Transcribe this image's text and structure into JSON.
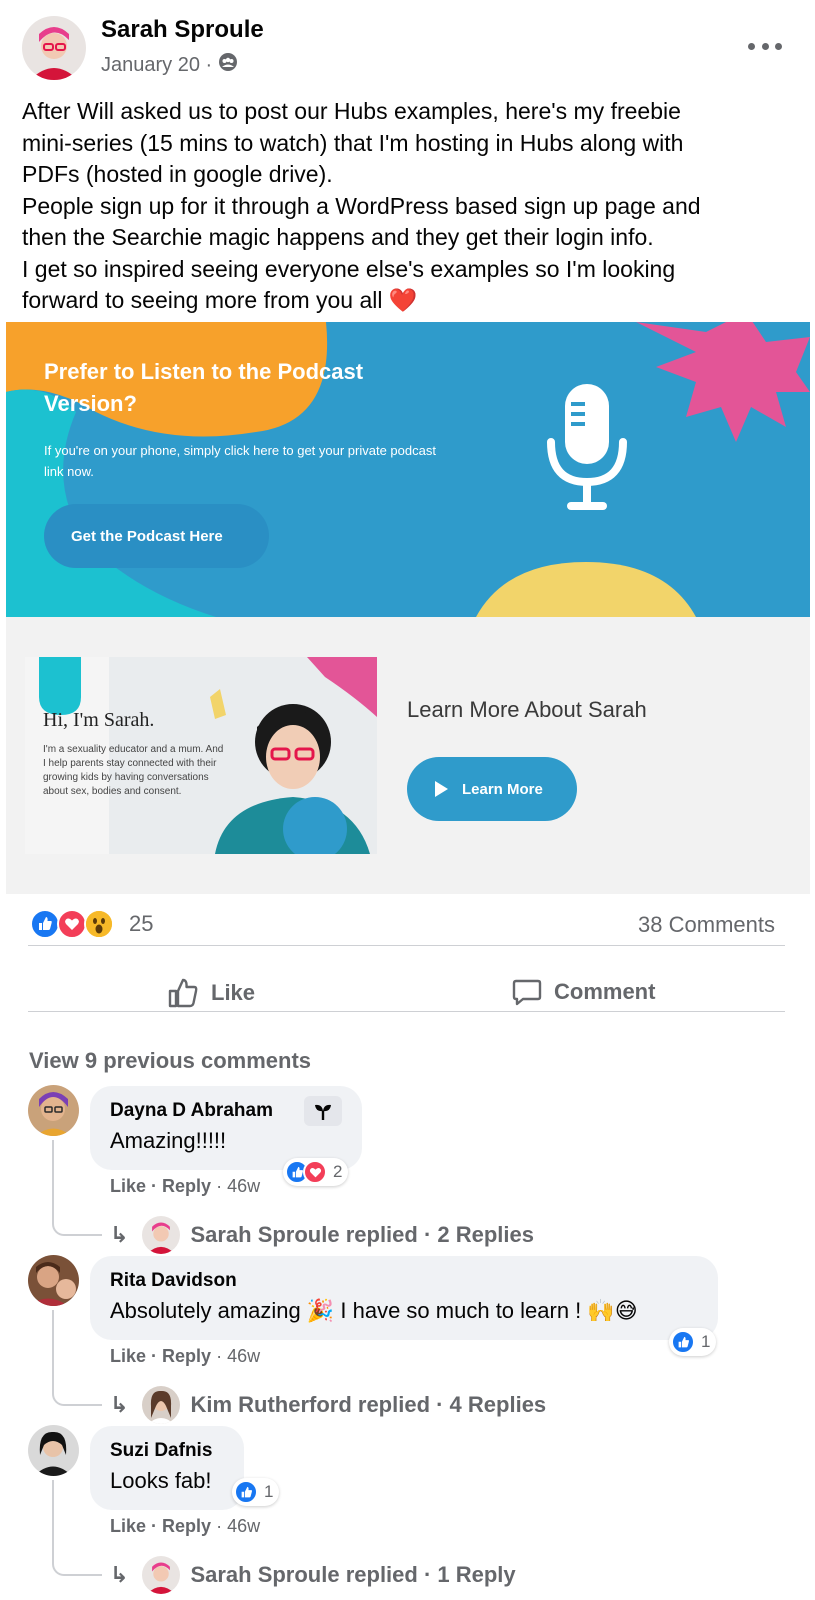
{
  "post": {
    "author": "Sarah Sproule",
    "date": "January 20 ·",
    "privacy_icon": "group-audience-icon",
    "more_icon": "more-options-icon",
    "text_lines": [
      "After Will asked us to post our Hubs examples, here's my freebie",
      "mini-series (15 mins to watch) that I'm hosting in Hubs along with",
      "PDFs (hosted in google drive).",
      "People sign up for it through a WordPress based sign up page and",
      "then the Searchie magic happens and they get their login info.",
      "I get so inspired seeing everyone else's examples so I'm looking",
      "forward to seeing more from you all ❤️"
    ]
  },
  "banner": {
    "title": "Prefer to Listen to the Podcast Version?",
    "subtitle": "If you're on your phone, simply click here to get your private podcast link now.",
    "button_label": "Get the Podcast Here",
    "icon": "microphone-icon",
    "colors": {
      "background": "#2f9bcb",
      "orange": "#f7a12b",
      "teal": "#1cc1d0",
      "pink": "#e35597",
      "yellow": "#f2d46a"
    }
  },
  "about": {
    "card_greeting": "Hi, I'm Sarah.",
    "card_bio": "I'm a sexuality educator and a mum. And I help parents stay connected with their growing kids by having conversations about sex, bodies and consent.",
    "heading": "Learn More About Sarah",
    "button_label": "Learn More"
  },
  "engagement": {
    "reaction_count": "25",
    "comments_label": "38 Comments",
    "reaction_icons": [
      "like-reaction-icon",
      "love-reaction-icon",
      "wow-reaction-icon"
    ],
    "like_label": "Like",
    "comment_label": "Comment"
  },
  "comments": {
    "view_previous": "View 9 previous comments",
    "items": [
      {
        "name": "Dayna D Abraham",
        "text": "Amazing!!!!!",
        "like": "Like",
        "reply": "Reply",
        "age": "· 46w",
        "reaction_count": "2",
        "replied_by": "Sarah Sproule replied · 2 Replies"
      },
      {
        "name": "Rita Davidson",
        "text": "Absolutely amazing 🎉 I have so much to learn ! 🙌😅",
        "like": "Like",
        "reply": "Reply",
        "age": "· 46w",
        "reaction_count": "1",
        "replied_by": "Kim Rutherford replied · 4 Replies"
      },
      {
        "name": "Suzi Dafnis",
        "text": "Looks fab!",
        "like": "Like",
        "reply": "Reply",
        "age": "· 46w",
        "reaction_count": "1",
        "replied_by": "Sarah Sproule replied · 1 Reply"
      }
    ]
  }
}
